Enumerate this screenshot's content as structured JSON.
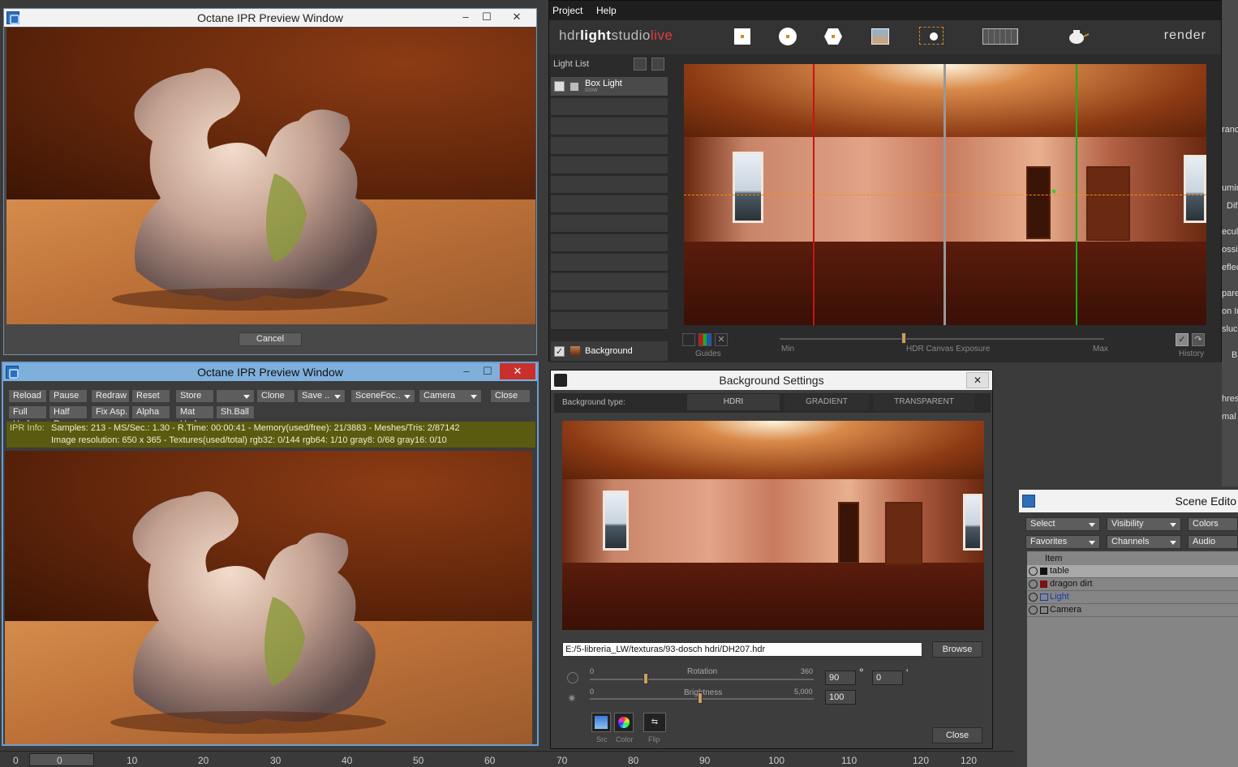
{
  "ipr_top": {
    "title": "Octane IPR Preview Window",
    "cancel_label": "Cancel"
  },
  "ipr_bottom": {
    "title": "Octane IPR Preview Window",
    "close_x": "✕",
    "row1": [
      "Reload",
      "Pause",
      "Redraw",
      "Reset",
      "Store",
      "",
      "Clone",
      "Save ..",
      "SceneFoc..",
      "Camera",
      "Close"
    ],
    "row2": [
      "Full Upd.",
      "Half Res",
      "Fix Asp.",
      "Alpha",
      "Mat Upd",
      "Sh.Ball"
    ],
    "info_label": "IPR Info:",
    "info_line1": "Samples: 213  -  MS/Sec.: 1.30  -  R.Time: 00:00:41  -  Memory(used/free): 21/3883  -  Meshes/Tris: 2/87142",
    "info_line2": "Image resolution: 650 x 365 - Textures(used/total) rgb32: 0/144   rgb64: 1/10   gray8: 0/68   gray16: 0/10"
  },
  "hdr": {
    "menu": [
      "Project",
      "Help"
    ],
    "logo_a": "hdr",
    "logo_b": "light",
    "logo_c": "studio",
    "logo_d": "live",
    "render_label": "render",
    "light_list_label": "Light List",
    "light_name": "Box Light",
    "light_sub": "500W",
    "background_label": "Background",
    "guides_label": "Guides",
    "min_label": "Min",
    "exposure_label": "HDR Canvas Exposure",
    "max_label": "Max",
    "history_label": "History"
  },
  "bgset": {
    "title": "Background Settings",
    "close_x": "✕",
    "type_label": "Background type:",
    "tabs": [
      "HDRI",
      "GRADIENT",
      "TRANSPARENT"
    ],
    "path_value": "E:/5-libreria_LW/texturas/93-dosch hdri/DH207.hdr",
    "browse_label": "Browse",
    "rotation_label": "Rotation",
    "rotation_min": "0",
    "rotation_max": "360",
    "rotation_value": "90",
    "rotation_deg": "°",
    "rotation_value2": "0",
    "rotation_min2": "'",
    "brightness_label": "Brightness",
    "brightness_min": "0",
    "brightness_max": "5,000",
    "brightness_value": "100",
    "src_label": "Src",
    "color_label": "Color",
    "flip_label": "Flip",
    "close_label": "Close"
  },
  "scene": {
    "title": "Scene Edito",
    "btns_row1": [
      "Select",
      "Visibility",
      "Colors"
    ],
    "btns_row2": [
      "Favorites",
      "Channels",
      "Audio"
    ],
    "item_header": "Item",
    "items": [
      "table",
      "dragon dirt",
      "Light",
      "Camera"
    ]
  },
  "right_edge": [
    "ranc",
    "umin",
    "Dif",
    "ecul",
    "ossi",
    "eflec",
    "pare",
    "on In",
    "sluce",
    "B",
    "hres",
    "mal"
  ],
  "timeline": {
    "ticks": [
      "0",
      "0",
      "10",
      "20",
      "30",
      "40",
      "50",
      "60",
      "70",
      "80",
      "90",
      "100",
      "110",
      "120",
      "120"
    ]
  },
  "colors": {
    "octane_btn": "#5d5d5d",
    "info_bar": "#5a5a10",
    "guide_red": "#c81414",
    "guide_green": "#18b018",
    "guide_orange": "#ff8a00",
    "close_red": "#c9302c"
  }
}
